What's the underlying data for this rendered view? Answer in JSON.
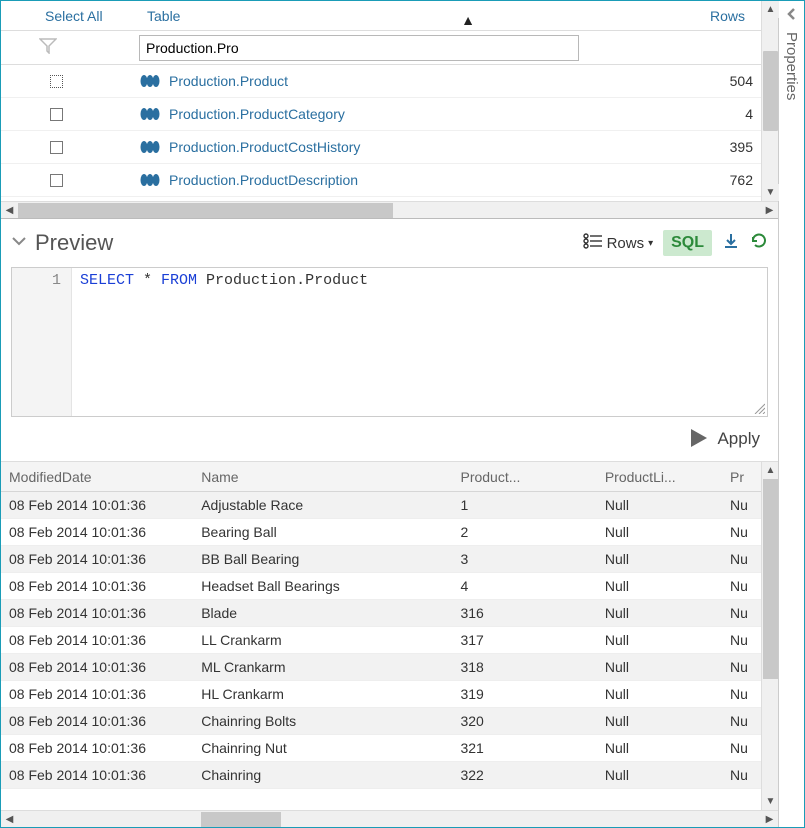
{
  "sidebar": {
    "label": "Properties"
  },
  "tables": {
    "header": {
      "select_all": "Select All",
      "table": "Table",
      "rows": "Rows"
    },
    "filter": "Production.Pro",
    "items": [
      {
        "name": "Production.Product",
        "rows": "504",
        "focused": true
      },
      {
        "name": "Production.ProductCategory",
        "rows": "4",
        "focused": false
      },
      {
        "name": "Production.ProductCostHistory",
        "rows": "395",
        "focused": false
      },
      {
        "name": "Production.ProductDescription",
        "rows": "762",
        "focused": false
      }
    ]
  },
  "preview": {
    "title": "Preview",
    "rows_label": "Rows",
    "sql_label": "SQL",
    "apply_label": "Apply",
    "line_no": "1",
    "sql": {
      "kw1": "SELECT",
      "star": " * ",
      "kw2": "FROM",
      "rest": " Production.Product"
    }
  },
  "results": {
    "columns": [
      "ModifiedDate",
      "Name",
      "Product...",
      "ProductLi...",
      "Pr"
    ],
    "rows": [
      [
        "08 Feb 2014 10:01:36",
        "Adjustable Race",
        "1",
        "Null",
        "Nu"
      ],
      [
        "08 Feb 2014 10:01:36",
        "Bearing Ball",
        "2",
        "Null",
        "Nu"
      ],
      [
        "08 Feb 2014 10:01:36",
        "BB Ball Bearing",
        "3",
        "Null",
        "Nu"
      ],
      [
        "08 Feb 2014 10:01:36",
        "Headset Ball Bearings",
        "4",
        "Null",
        "Nu"
      ],
      [
        "08 Feb 2014 10:01:36",
        "Blade",
        "316",
        "Null",
        "Nu"
      ],
      [
        "08 Feb 2014 10:01:36",
        "LL Crankarm",
        "317",
        "Null",
        "Nu"
      ],
      [
        "08 Feb 2014 10:01:36",
        "ML Crankarm",
        "318",
        "Null",
        "Nu"
      ],
      [
        "08 Feb 2014 10:01:36",
        "HL Crankarm",
        "319",
        "Null",
        "Nu"
      ],
      [
        "08 Feb 2014 10:01:36",
        "Chainring Bolts",
        "320",
        "Null",
        "Nu"
      ],
      [
        "08 Feb 2014 10:01:36",
        "Chainring Nut",
        "321",
        "Null",
        "Nu"
      ],
      [
        "08 Feb 2014 10:01:36",
        "Chainring",
        "322",
        "Null",
        "Nu"
      ]
    ]
  }
}
